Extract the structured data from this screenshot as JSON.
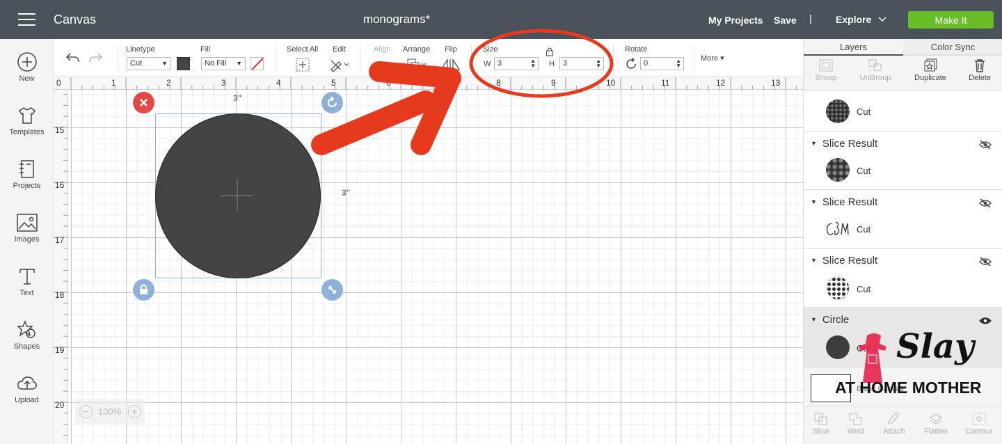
{
  "topbar": {
    "app_title": "Canvas",
    "document_title": "monograms*",
    "my_projects": "My Projects",
    "save": "Save",
    "separator": "|",
    "explore": "Explore",
    "make_it": "Make It",
    "make_it_color": "#69be28",
    "bar_color": "#4a5259"
  },
  "sidebar": {
    "items": [
      {
        "label": "New",
        "icon": "plus-circle-icon"
      },
      {
        "label": "Templates",
        "icon": "tshirt-icon"
      },
      {
        "label": "Projects",
        "icon": "notebook-icon"
      },
      {
        "label": "Images",
        "icon": "image-icon"
      },
      {
        "label": "Text",
        "icon": "text-icon"
      },
      {
        "label": "Shapes",
        "icon": "shapes-icon"
      },
      {
        "label": "Upload",
        "icon": "cloud-upload-icon"
      }
    ]
  },
  "toolbar": {
    "linetype_label": "Linetype",
    "linetype_value": "Cut",
    "fill_label": "Fill",
    "fill_value": "No Fill",
    "select_all": "Select All",
    "edit": "Edit",
    "align": "Align",
    "arrange": "Arrange",
    "flip": "Flip",
    "size_label": "Size",
    "width_label": "W",
    "width_value": "3",
    "height_label": "H",
    "height_value": "3",
    "rotate_label": "Rotate",
    "rotate_value": "0",
    "more": "More"
  },
  "rulers": {
    "top": [
      "0",
      "1",
      "2",
      "3",
      "4",
      "5",
      "6",
      "7",
      "8",
      "9",
      "10",
      "11",
      "12",
      "13"
    ],
    "left": [
      "15",
      "16",
      "17",
      "18",
      "19",
      "20"
    ]
  },
  "canvas": {
    "shape_width_label": "3\"",
    "shape_height_label": "3\"",
    "shape_color": "#444444",
    "zoom_level": "100%",
    "annotation_color": "#e53a1e"
  },
  "layers_panel": {
    "tabs": [
      "Layers",
      "Color Sync"
    ],
    "actions": [
      {
        "label": "Group",
        "enabled": false
      },
      {
        "label": "UnGroup",
        "enabled": false
      },
      {
        "label": "Duplicate",
        "enabled": true
      },
      {
        "label": "Delete",
        "enabled": true
      }
    ],
    "top_layer_cut": "Cut",
    "groups": [
      {
        "name": "Slice Result",
        "cut": "Cut",
        "visible": false
      },
      {
        "name": "Slice Result",
        "cut": "Cut",
        "visible": false
      },
      {
        "name": "Slice Result",
        "cut": "Cut",
        "visible": false
      },
      {
        "name": "Circle",
        "cut": "Cut",
        "visible": true
      }
    ],
    "blank_canvas": "Blank Canvas",
    "bottom_actions": [
      "Slice",
      "Weld",
      "Attach",
      "Flatten",
      "Contour"
    ]
  },
  "watermark": {
    "line1": "Slay",
    "line2": "AT HOME MOTHER"
  }
}
